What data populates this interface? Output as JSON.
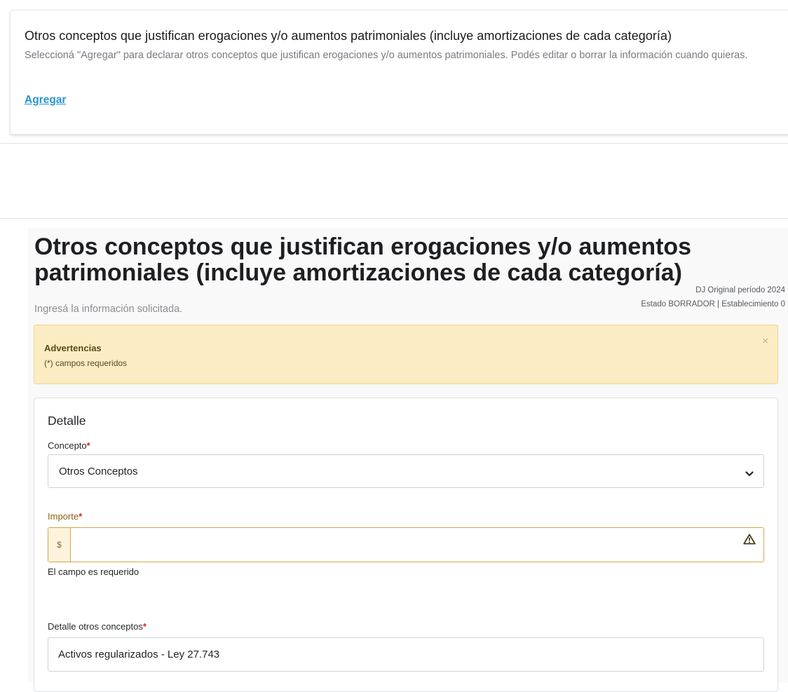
{
  "summary_card": {
    "title": "Otros conceptos que justifican erogaciones y/o aumentos patrimoniales (incluye amortizaciones de cada categoría)",
    "description": "Seleccioná \"Agregar\" para declarar otros conceptos que justifican erogaciones y/o aumentos patrimoniales. Podés editar o borrar la información cuando quieras.",
    "add_link": "Agregar"
  },
  "form_page": {
    "title": "Otros conceptos que justifican erogaciones y/o aumentos patrimoniales (incluye amortizaciones de cada categoría)",
    "subtitle": "Ingresá la información solicitada.",
    "meta_line1": "DJ Original período 2024",
    "meta_line2": "Estado BORRADOR | Establecimiento 0",
    "alert": {
      "title": "Advertencias",
      "text": "(*) campos requeridos",
      "close": "×"
    },
    "detail": {
      "section_title": "Detalle",
      "concepto": {
        "label": "Concepto",
        "required_mark": "*",
        "value": "Otros Conceptos"
      },
      "importe": {
        "label": "Importe",
        "required_mark": "*",
        "prefix": "$",
        "value": "",
        "error": "El campo es requerido"
      },
      "detalle_otros": {
        "label": "Detalle otros conceptos",
        "required_mark": "*",
        "value": "Activos regularizados - Ley 27.743"
      }
    }
  },
  "icons": {
    "select": "chevron-down-icon",
    "warning": "warning-triangle-icon",
    "alert_close": "close-icon"
  },
  "colors": {
    "link": "#2a95cf",
    "alert_bg": "#fcecc3",
    "error_border": "#d3a64b",
    "required": "#d9261c"
  }
}
